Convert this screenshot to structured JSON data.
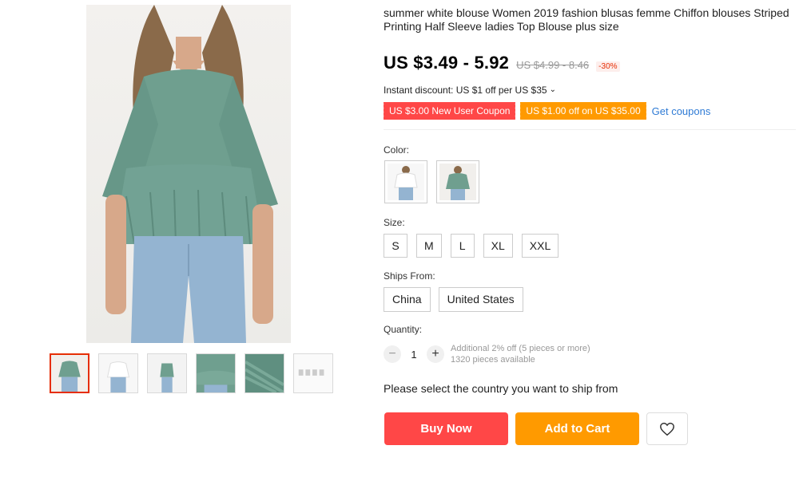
{
  "product": {
    "title": "summer white blouse Women 2019 fashion blusas femme Chiffon blouses Striped Printing Half Sleeve ladies Top Blouse plus size"
  },
  "price": {
    "current": "US $3.49 - 5.92",
    "original": "US $4.99 - 8.46",
    "discount": "-30%"
  },
  "instant_discount": "Instant discount: US $1 off per US $35",
  "coupons": {
    "new_user": "US $3.00 New User Coupon",
    "store": "US $1.00 off on US $35.00",
    "get_label": "Get coupons"
  },
  "color": {
    "label": "Color:",
    "options": [
      "white",
      "green"
    ]
  },
  "size": {
    "label": "Size:",
    "options": [
      "S",
      "M",
      "L",
      "XL",
      "XXL"
    ]
  },
  "ships_from": {
    "label": "Ships From:",
    "options": [
      "China",
      "United States"
    ]
  },
  "quantity": {
    "label": "Quantity:",
    "value": "1",
    "minus": "−",
    "plus": "+",
    "promo": "Additional 2% off (5 pieces or more)",
    "available": "1320 pieces available"
  },
  "ship_notice": "Please select the country you want to ship from",
  "actions": {
    "buy_now": "Buy Now",
    "add_to_cart": "Add to Cart"
  },
  "colors": {
    "blouse_green": "#6f9f8f",
    "jeans_blue": "#94b4d1",
    "accent_red": "#ff4747",
    "accent_orange": "#ff9a00",
    "link_blue": "#2f7bd5",
    "active_thumb_border": "#e62e04"
  },
  "icons": {
    "chevron": "chevron-down-icon",
    "wishlist": "heart-icon"
  }
}
